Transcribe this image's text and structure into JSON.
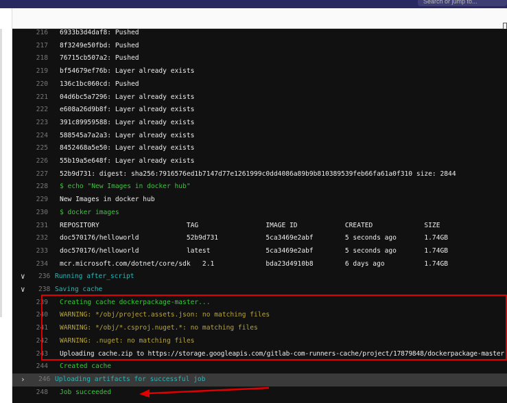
{
  "topbar": {
    "search_placeholder": "Search or jump to..."
  },
  "log": [
    {
      "n": "216",
      "t": "6933b3d4daf8: Pushed",
      "c": ""
    },
    {
      "n": "217",
      "t": "8f3249e50fbd: Pushed",
      "c": ""
    },
    {
      "n": "218",
      "t": "76715cb507a2: Pushed",
      "c": ""
    },
    {
      "n": "219",
      "t": "bf54679ef76b: Layer already exists",
      "c": ""
    },
    {
      "n": "220",
      "t": "136c1bc060cd: Pushed",
      "c": ""
    },
    {
      "n": "221",
      "t": "04d6bc5a7296: Layer already exists",
      "c": ""
    },
    {
      "n": "222",
      "t": "e608a26d9b8f: Layer already exists",
      "c": ""
    },
    {
      "n": "223",
      "t": "391c89959588: Layer already exists",
      "c": ""
    },
    {
      "n": "224",
      "t": "588545a7a2a3: Layer already exists",
      "c": ""
    },
    {
      "n": "225",
      "t": "8452468a5e50: Layer already exists",
      "c": ""
    },
    {
      "n": "226",
      "t": "55b19a5e648f: Layer already exists",
      "c": ""
    },
    {
      "n": "227",
      "t": "52b9d731: digest: sha256:7916576ed1b7147d77e1261999c0dd4086a89b9b810389539feb66fa61a0f310 size: 2844",
      "c": ""
    },
    {
      "n": "228",
      "t": "$ echo \"New Images in docker hub\"",
      "c": "green"
    },
    {
      "n": "229",
      "t": "New Images in docker hub",
      "c": ""
    },
    {
      "n": "230",
      "t": "$ docker images",
      "c": "green"
    },
    {
      "n": "231",
      "t": "REPOSITORY                      TAG                 IMAGE ID            CREATED             SIZE",
      "c": ""
    },
    {
      "n": "232",
      "t": "doc570176/helloworld            52b9d731            5ca3469e2abf        5 seconds ago       1.74GB",
      "c": ""
    },
    {
      "n": "233",
      "t": "doc570176/helloworld            latest              5ca3469e2abf        5 seconds ago       1.74GB",
      "c": ""
    },
    {
      "n": "234",
      "t": "mcr.microsoft.com/dotnet/core/sdk   2.1             bda23d4910b8        6 days ago          1.74GB",
      "c": ""
    },
    {
      "n": "236",
      "t": "Running after_script",
      "c": "cyan",
      "sec": "down"
    },
    {
      "n": "238",
      "t": "Saving cache",
      "c": "cyan",
      "sec": "down"
    },
    {
      "n": "239",
      "t": "Creating cache dockerpackage-master...",
      "c": "green"
    },
    {
      "n": "240",
      "t": "WARNING: */obj/project.assets.json: no matching files",
      "c": "warn"
    },
    {
      "n": "241",
      "t": "WARNING: */obj/*.csproj.nuget.*: no matching files",
      "c": "warn"
    },
    {
      "n": "242",
      "t": "WARNING: .nuget: no matching files",
      "c": "warn"
    },
    {
      "n": "243",
      "t": "Uploading cache.zip to https://storage.googleapis.com/gitlab-com-runners-cache/project/17879848/dockerpackage-master",
      "c": ""
    },
    {
      "n": "244",
      "t": "Created cache",
      "c": "green"
    },
    {
      "n": "246",
      "t": "Uploading artifacts for successful job",
      "c": "cyan",
      "sec": "right"
    },
    {
      "n": "248",
      "t": "Job succeeded",
      "c": "green"
    }
  ]
}
